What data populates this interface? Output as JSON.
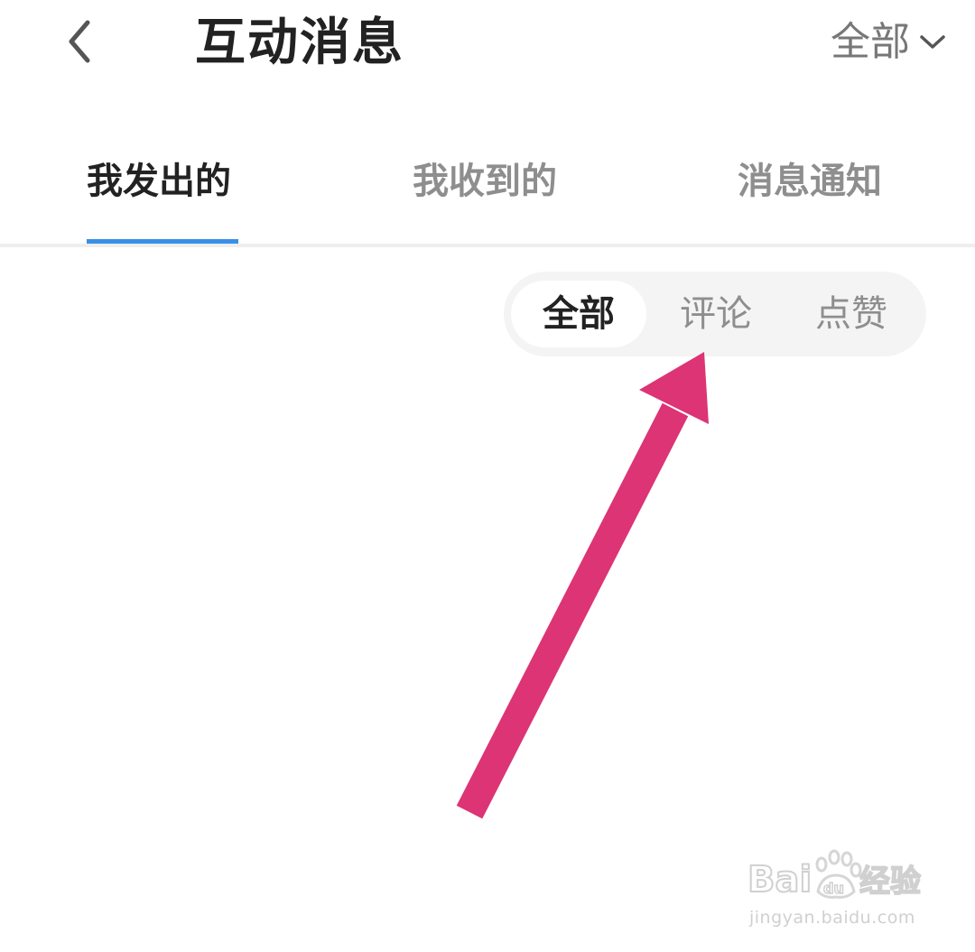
{
  "header": {
    "back_icon": "chevron-left-icon",
    "title": "互动消息",
    "filter": {
      "label": "全部",
      "icon": "chevron-down-icon"
    }
  },
  "tabs": [
    {
      "label": "我发出的",
      "active": true
    },
    {
      "label": "我收到的",
      "active": false
    },
    {
      "label": "消息通知",
      "active": false
    }
  ],
  "segmented": [
    {
      "label": "全部",
      "active": true
    },
    {
      "label": "评论",
      "active": false
    },
    {
      "label": "点赞",
      "active": false
    }
  ],
  "annotation": {
    "type": "arrow",
    "color": "#dc3474",
    "points_to": "评论"
  },
  "watermark": {
    "logo": "Baidu经验",
    "url": "jingyan.baidu.com"
  },
  "colors": {
    "accent": "#3a8fe6",
    "text_primary": "#222222",
    "text_secondary": "#8e8e8e",
    "arrow": "#dc3474"
  }
}
